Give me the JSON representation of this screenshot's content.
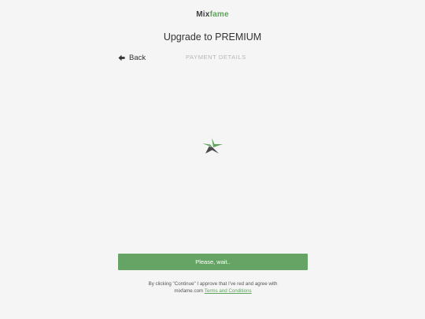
{
  "header": {
    "logo_part1": "Mix",
    "logo_part2": "fame",
    "title": "Upgrade to PREMIUM"
  },
  "nav": {
    "back_label": "Back",
    "back_icon": "arrow-left-icon",
    "step_label": "PAYMENT DETAILS"
  },
  "loader": {
    "icon": "star-logo-icon",
    "colors": {
      "green": "#5ea35e",
      "dark": "#4a4a4a"
    }
  },
  "action": {
    "button_label": "Please, wait..",
    "button_color": "#66a466"
  },
  "agreement": {
    "line1": "By clicking \"Continue\" I approve that I've red and agree with",
    "line2_prefix": "mixfame.com ",
    "link_text": "Terms and Conditions"
  }
}
